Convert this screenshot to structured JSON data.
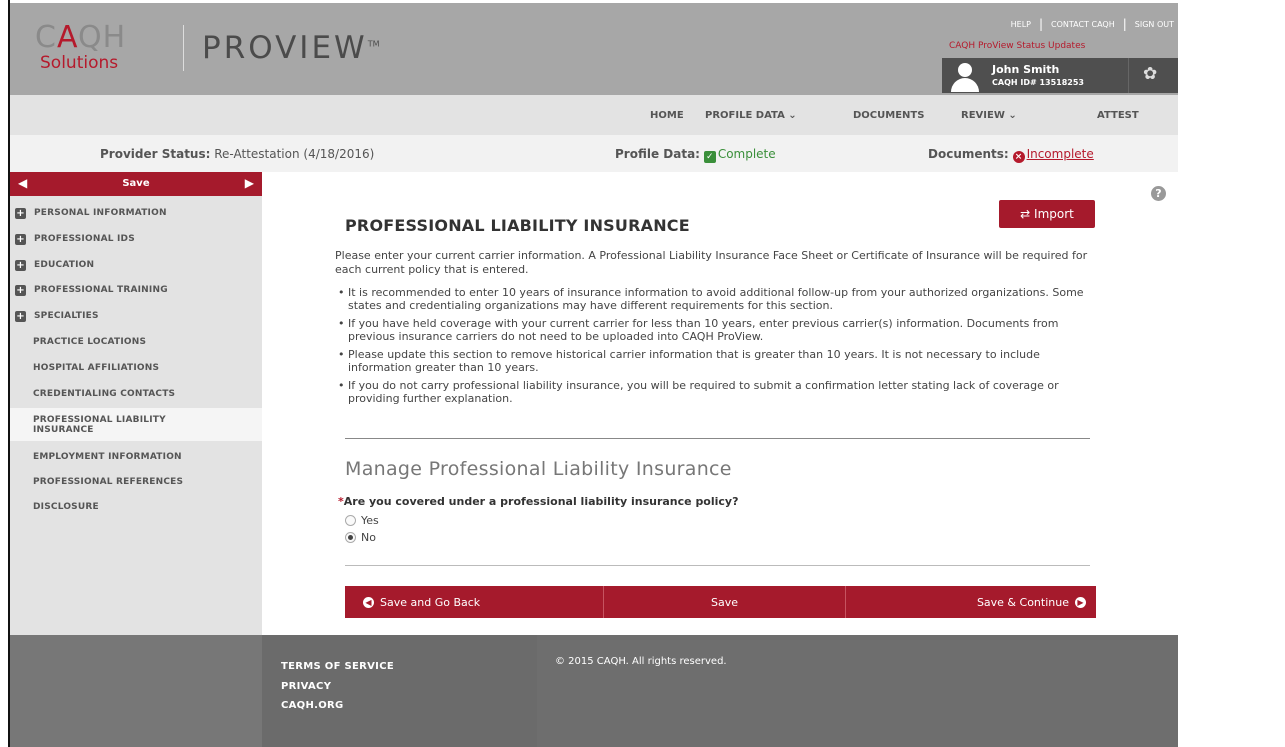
{
  "header": {
    "logo_caqh_c": "C",
    "logo_caqh_a": "A",
    "logo_caqh_qh": "QH",
    "logo_solutions": "Solutions",
    "product": "PROVIEW",
    "product_tm": "TM",
    "links": [
      "HELP",
      "CONTACT CAQH",
      "SIGN OUT"
    ],
    "status_updates": "CAQH ProView Status Updates",
    "user": {
      "name": "John Smith",
      "id": "CAQH ID# 13518253"
    }
  },
  "nav": {
    "items": [
      "HOME",
      "PROFILE DATA ⌄",
      "DOCUMENTS",
      "REVIEW ⌄",
      "ATTEST"
    ]
  },
  "status": {
    "provider_label": "Provider Status:",
    "provider_value": "Re-Attestation (4/18/2016)",
    "profile_label": "Profile Data:",
    "profile_value": "Complete",
    "documents_label": "Documents:",
    "documents_value": "Incomplete"
  },
  "sidebar": {
    "save_label": "Save",
    "items": [
      "PERSONAL INFORMATION",
      "PROFESSIONAL IDS",
      "EDUCATION",
      "PROFESSIONAL TRAINING",
      "SPECIALTIES",
      "PRACTICE LOCATIONS",
      "HOSPITAL AFFILIATIONS",
      "CREDENTIALING CONTACTS",
      "PROFESSIONAL LIABILITY INSURANCE",
      "EMPLOYMENT INFORMATION",
      "PROFESSIONAL REFERENCES",
      "DISCLOSURE"
    ]
  },
  "main": {
    "title": "PROFESSIONAL LIABILITY INSURANCE",
    "import_label": "Import",
    "intro": "Please enter your current carrier information.  A Professional Liability Insurance Face Sheet or Certificate of Insurance will be required for each current policy that is entered.",
    "bullets": [
      "It is recommended to enter 10 years of insurance information to avoid additional follow-up from your authorized organizations.  Some states and credentialing organizations may have different requirements for this section.",
      "If you have held coverage with your current carrier for less than 10 years, enter previous carrier(s) information. Documents from previous insurance carriers do not need to be uploaded into CAQH ProView.",
      "Please update this section to remove historical carrier information that is greater than 10 years.  It is not necessary to include information greater than 10 years.",
      "If you do not carry professional liability insurance, you will be required to submit a confirmation letter stating lack of coverage or providing further explanation."
    ],
    "section_title": "Manage Professional Liability Insurance",
    "question_required": "*",
    "question": "Are you covered under a professional liability insurance policy?",
    "options": [
      "Yes",
      "No"
    ],
    "selected_option": "No",
    "actions": {
      "back": "Save and Go Back",
      "save": "Save",
      "continue": "Save & Continue"
    }
  },
  "footer": {
    "links": [
      "TERMS OF SERVICE",
      "PRIVACY",
      "CAQH.ORG"
    ],
    "copyright": "© 2015 CAQH. All rights reserved."
  },
  "colors": {
    "brand_red": "#a51a2c",
    "header_gray": "#a7a7a7",
    "complete_green": "#3a8f3a"
  }
}
